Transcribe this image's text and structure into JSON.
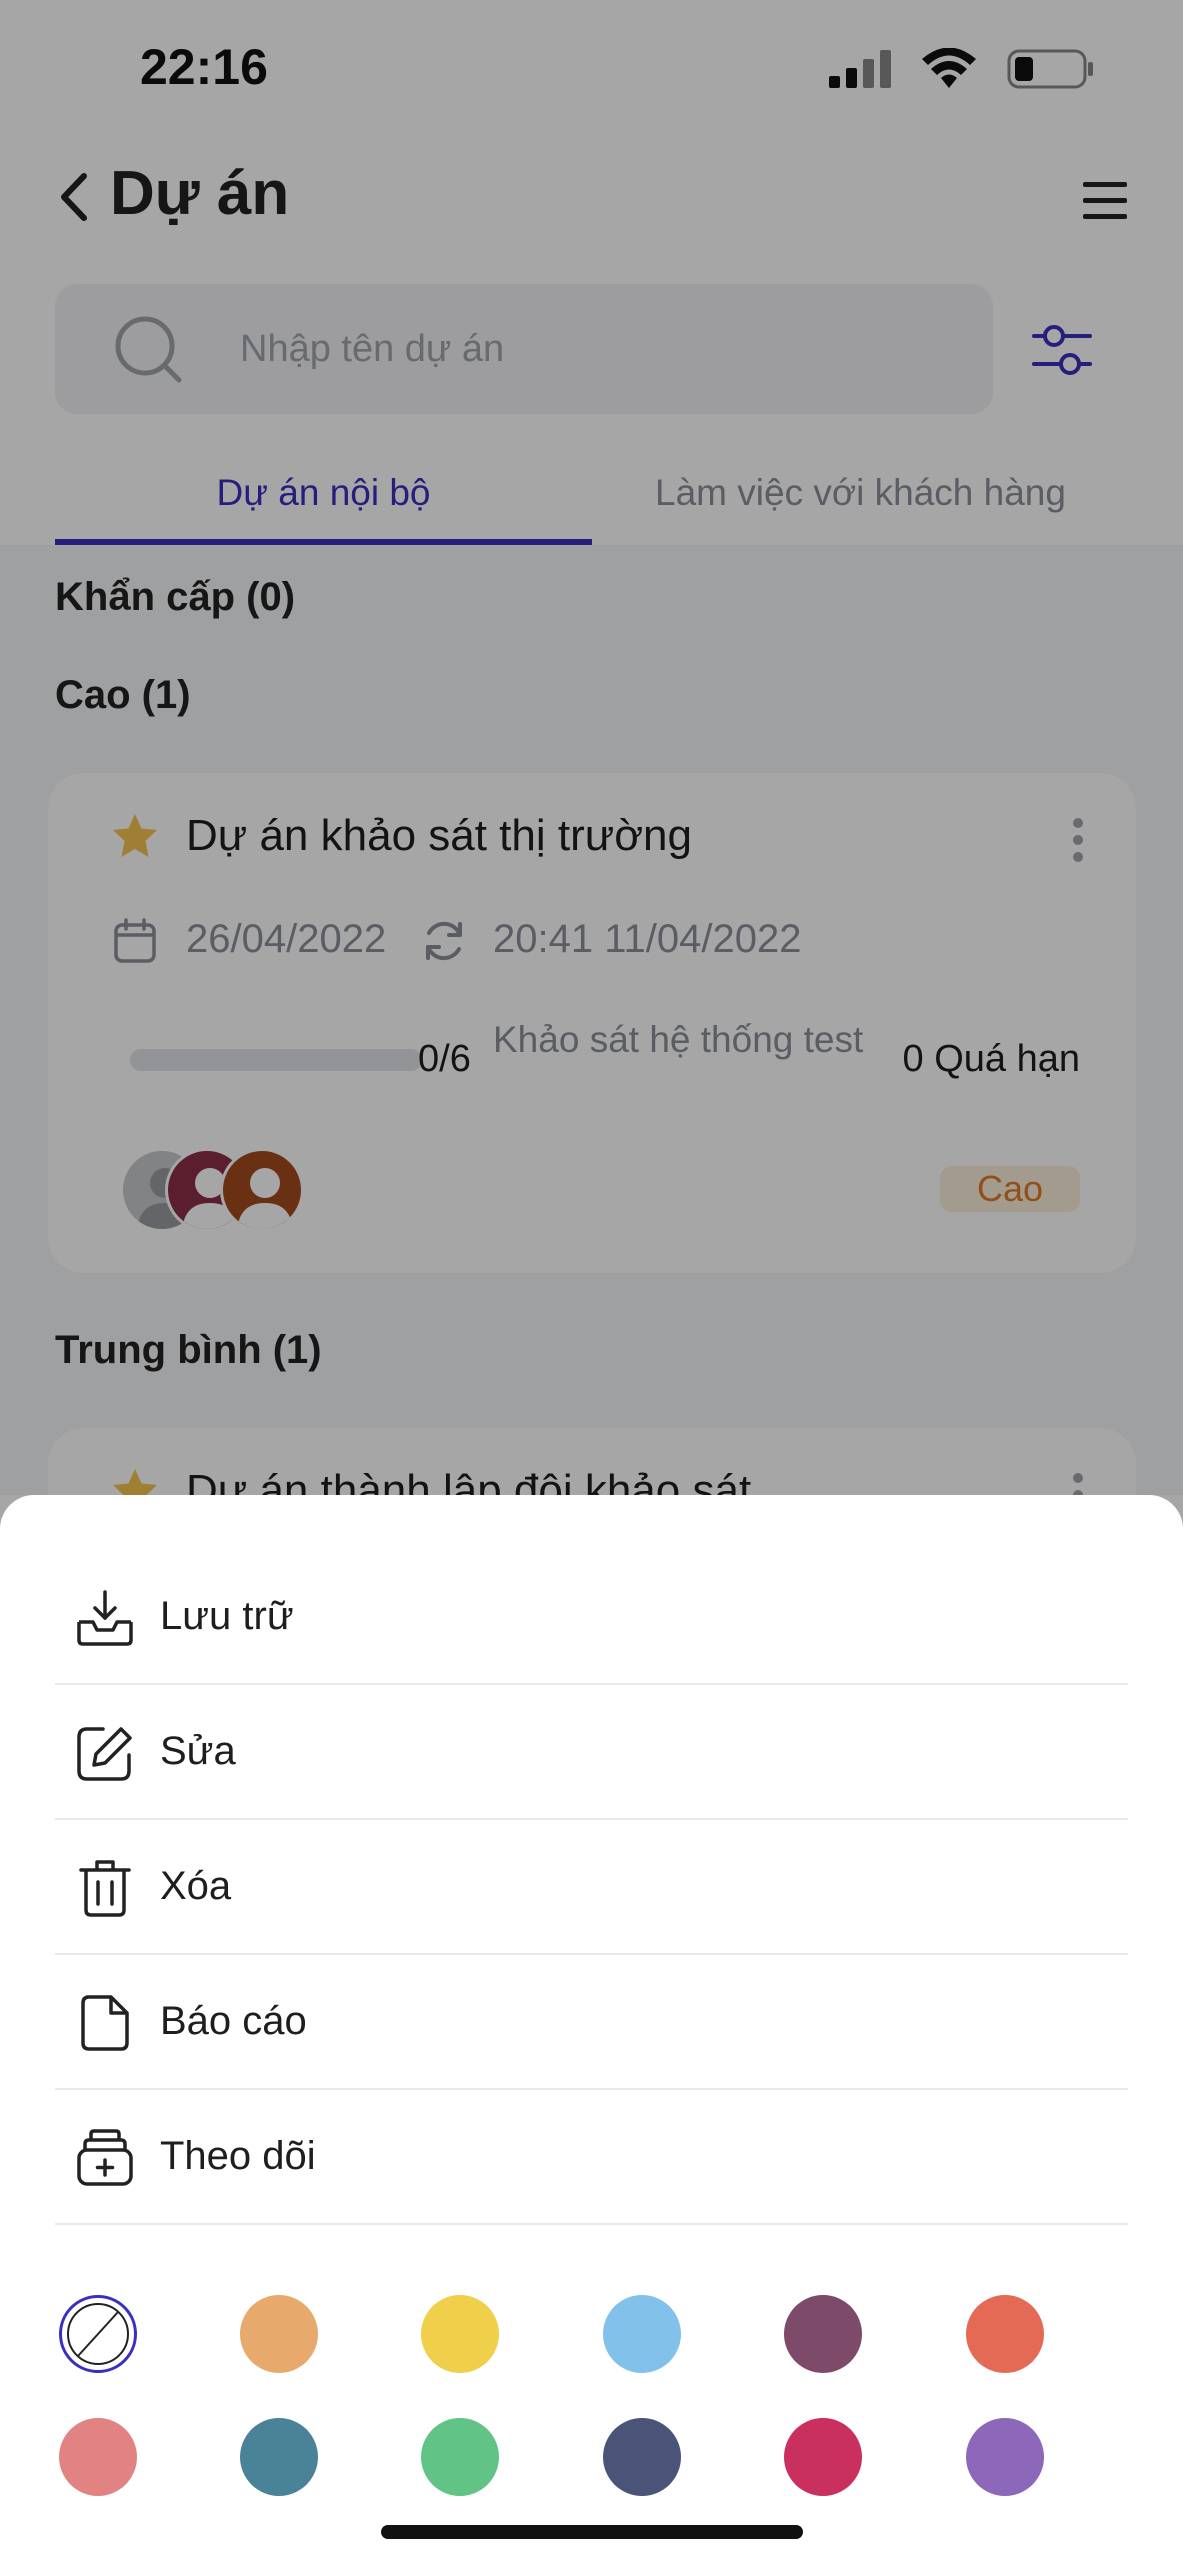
{
  "status_bar": {
    "time": "22:16"
  },
  "nav": {
    "title": "Dự án"
  },
  "search": {
    "placeholder": "Nhập tên dự án"
  },
  "tabs": [
    {
      "label": "Dự án nội bộ",
      "active": true
    },
    {
      "label": "Làm việc với khách hàng",
      "active": false
    }
  ],
  "groups": [
    {
      "title": "Khẩn cấp (0)"
    },
    {
      "title": "Cao (1)"
    },
    {
      "title": "Trung bình (1)"
    }
  ],
  "cards": [
    {
      "title": "Dự án khảo sát thị trường",
      "date": "26/04/2022",
      "updated": "20:41 11/04/2022",
      "progress_count": "0/6",
      "progress_fraction": 0,
      "task": "Khảo sát hệ thống test",
      "overdue": "0 Quá hạn",
      "priority": "Cao"
    },
    {
      "title": "Dự án thành lập đội khảo sát"
    }
  ],
  "sheet": {
    "items": [
      {
        "label": "Lưu trữ",
        "icon": "archive-icon"
      },
      {
        "label": "Sửa",
        "icon": "edit-icon"
      },
      {
        "label": "Xóa",
        "icon": "trash-icon"
      },
      {
        "label": "Báo cáo",
        "icon": "document-icon"
      },
      {
        "label": "Theo dõi",
        "icon": "follow-icon"
      }
    ],
    "colors": [
      "none",
      "#e8a96d",
      "#f0cf4a",
      "#82c1e9",
      "#7d4a69",
      "#e46a55",
      "#e28383",
      "#4a8298",
      "#62c386",
      "#4a5479",
      "#c9305d",
      "#8d67ba"
    ]
  },
  "accent_color": "#3a2fc0"
}
